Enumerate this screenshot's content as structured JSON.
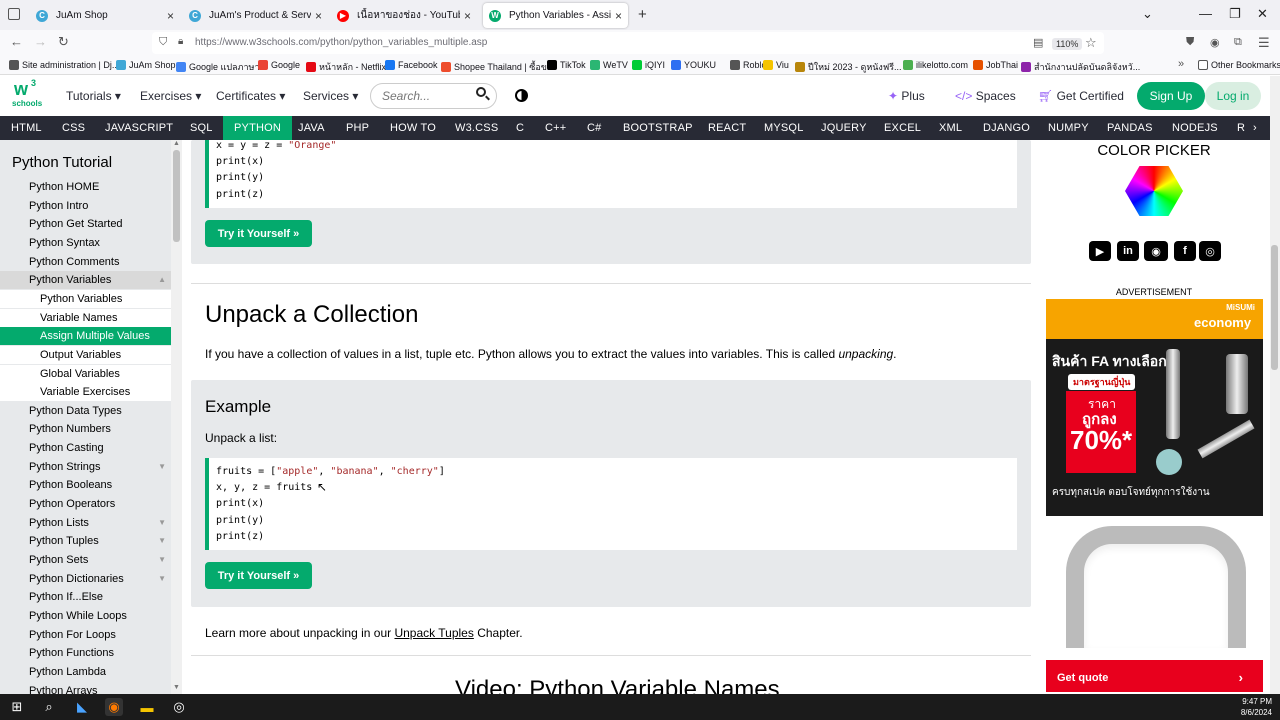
{
  "browser": {
    "tabs": [
      {
        "title": "JuAm Shop",
        "icon": "globe-icon"
      },
      {
        "title": "JuAm's Product & Service",
        "icon": "globe-icon"
      },
      {
        "title": "เนื้อหาของช่อง - YouTube Studio",
        "icon": "youtube-icon"
      },
      {
        "title": "Python Variables - Assign Multi",
        "icon": "w3schools-icon",
        "active": true
      }
    ],
    "new_tab": "+",
    "url": "https://www.w3schools.com/python/python_variables_multiple.asp",
    "zoom": "110%",
    "bookmarks": [
      {
        "label": "Site administration | Dj...",
        "color": "#555"
      },
      {
        "label": "JuAm Shop",
        "color": "#3fa7d6"
      },
      {
        "label": "Google แปลภาษา",
        "color": "#4285f4"
      },
      {
        "label": "Google",
        "color": "#ea4335"
      },
      {
        "label": "หน้าหลัก - Netflix",
        "color": "#e50914"
      },
      {
        "label": "Facebook",
        "color": "#1877f2"
      },
      {
        "label": "Shopee Thailand | ซื้อข...",
        "color": "#ee4d2d"
      },
      {
        "label": "TikTok",
        "color": "#000"
      },
      {
        "label": "WeTV",
        "color": "#2bb673"
      },
      {
        "label": "iQIYI",
        "color": "#00cc36"
      },
      {
        "label": "YOUKU",
        "color": "#2e6ff2"
      },
      {
        "label": "Roblox",
        "color": "#555"
      },
      {
        "label": "Viu",
        "color": "#f5c400"
      },
      {
        "label": "ปีใหม่ 2023 - ดูหนังฟรี...",
        "color": "#b8860b"
      },
      {
        "label": "ilikelotto.com",
        "color": "#4caf50"
      },
      {
        "label": "JobThai",
        "color": "#e65100"
      },
      {
        "label": "สำนักงานปลัดบันดลิจังหวั...",
        "color": "#8e24aa"
      }
    ],
    "other_bookmarks": "Other Bookmarks"
  },
  "w3header": {
    "logo_text": "w3\nschools",
    "menu": [
      "Tutorials",
      "Exercises",
      "Certificates",
      "Services"
    ],
    "search_placeholder": "Search...",
    "plus": "Plus",
    "spaces": "Spaces",
    "get_certified": "Get Certified",
    "sign_up": "Sign Up",
    "log_in": "Log in"
  },
  "subjects": [
    "HTML",
    "CSS",
    "JAVASCRIPT",
    "SQL",
    "PYTHON",
    "JAVA",
    "PHP",
    "HOW TO",
    "W3.CSS",
    "C",
    "C++",
    "C#",
    "BOOTSTRAP",
    "REACT",
    "MYSQL",
    "JQUERY",
    "EXCEL",
    "XML",
    "DJANGO",
    "NUMPY",
    "PANDAS",
    "NODEJS",
    "R"
  ],
  "sidebar": {
    "title": "Python Tutorial",
    "items": [
      {
        "label": "Python HOME"
      },
      {
        "label": "Python Intro"
      },
      {
        "label": "Python Get Started"
      },
      {
        "label": "Python Syntax"
      },
      {
        "label": "Python Comments"
      },
      {
        "label": "Python Variables",
        "open": true
      },
      {
        "label": "Python Variables",
        "sub": true
      },
      {
        "label": "Variable Names",
        "sub": true
      },
      {
        "label": "Assign Multiple Values",
        "sub": true,
        "selected": true
      },
      {
        "label": "Output Variables",
        "sub": true
      },
      {
        "label": "Global Variables",
        "sub": true
      },
      {
        "label": "Variable Exercises",
        "sub": true
      },
      {
        "label": "Python Data Types"
      },
      {
        "label": "Python Numbers"
      },
      {
        "label": "Python Casting"
      },
      {
        "label": "Python Strings",
        "chevron": true
      },
      {
        "label": "Python Booleans"
      },
      {
        "label": "Python Operators"
      },
      {
        "label": "Python Lists",
        "chevron": true
      },
      {
        "label": "Python Tuples",
        "chevron": true
      },
      {
        "label": "Python Sets",
        "chevron": true
      },
      {
        "label": "Python Dictionaries",
        "chevron": true
      },
      {
        "label": "Python If...Else"
      },
      {
        "label": "Python While Loops"
      },
      {
        "label": "Python For Loops"
      },
      {
        "label": "Python Functions"
      },
      {
        "label": "Python Lambda"
      },
      {
        "label": "Python Arrays"
      }
    ]
  },
  "main": {
    "code1": [
      {
        "a": "x = y = z = ",
        "s": "\"Orange\""
      },
      {
        "a": "print(x)",
        "s": ""
      },
      {
        "a": "print(y)",
        "s": ""
      },
      {
        "a": "print(z)",
        "s": ""
      }
    ],
    "try_label": "Try it Yourself »",
    "heading": "Unpack a Collection",
    "intro": "If you have a collection of values in a list, tuple etc. Python allows you to extract the values into variables. This is called ",
    "intro_em": "unpacking",
    "intro_end": ".",
    "example_heading": "Example",
    "example_sub": "Unpack a list:",
    "code2_line1_a": "fruits = [",
    "code2_line1_s1": "\"apple\"",
    "code2_line1_sep1": ", ",
    "code2_line1_s2": "\"banana\"",
    "code2_line1_sep2": ", ",
    "code2_line1_s3": "\"cherry\"",
    "code2_line1_b": "]",
    "code2_rest": [
      "x, y, z = fruits",
      "print(x)",
      "print(y)",
      "print(z)"
    ],
    "learn_pre": "Learn more about unpacking in our ",
    "learn_link": "Unpack Tuples",
    "learn_post": " Chapter.",
    "video_heading": "Video: Python Variable Names"
  },
  "right": {
    "color_picker": "COLOR PICKER",
    "advertisement": "ADVERTISEMENT",
    "ad_brand": "economy",
    "ad_brand_top": "MiSUMi",
    "ad_thai_1": "สินค้า FA ทางเลือก",
    "ad_thai_2": "มาตรฐานญี่ปุ่น",
    "ad_price_label": "ราคา",
    "ad_cheap": "ถูกลง",
    "ad_percent": "70%*",
    "ad_footer": "ครบทุกสเปค ตอบโจทย์ทุกการใช้งาน",
    "get_quote": "Get quote"
  },
  "taskbar": {
    "time": "9:47 PM",
    "date": "8/6/2024"
  }
}
